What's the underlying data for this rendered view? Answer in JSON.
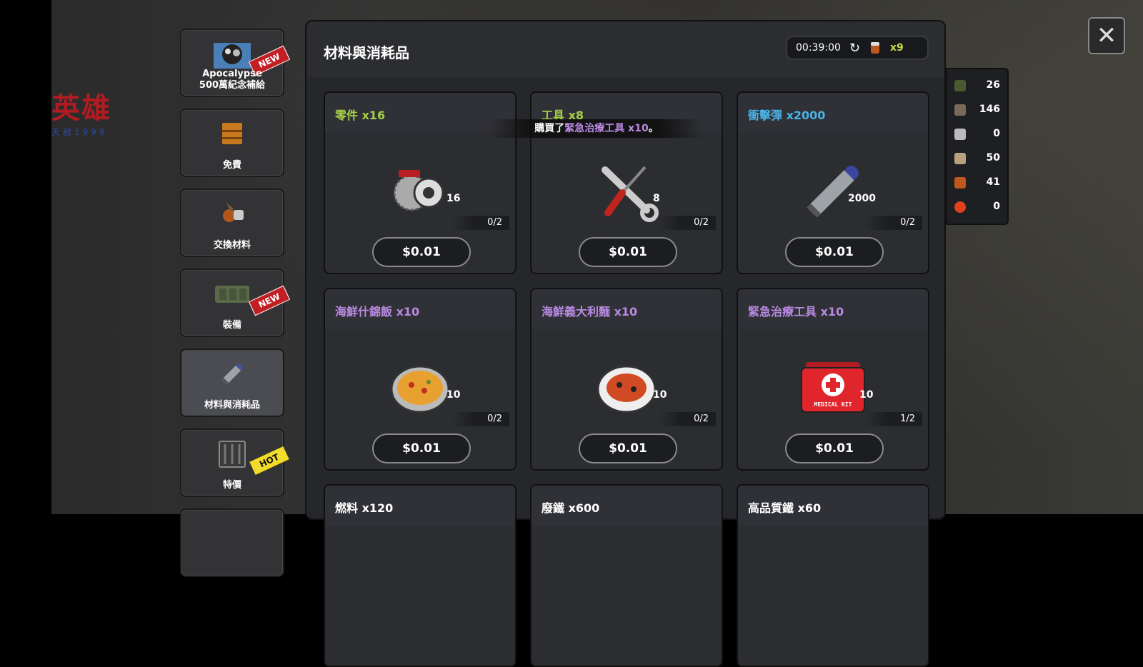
{
  "logo": {
    "title": "英雄",
    "subtitle": "天敌1999"
  },
  "title": "材料與消耗品",
  "timer": "00:39:00",
  "currency_count": "x9",
  "toast": {
    "prefix": "購買了",
    "item": "緊急治療工具 x10",
    "suffix": "。"
  },
  "sidebar": [
    {
      "label": "Apocalypse\n500萬紀念補給",
      "badge": "NEW",
      "icon": "apocalypse-icon"
    },
    {
      "label": "免費",
      "badge": "",
      "icon": "chest-icon"
    },
    {
      "label": "交換材料",
      "badge": "",
      "icon": "materials-icon"
    },
    {
      "label": "裝備",
      "badge": "NEW",
      "icon": "equipment-case-icon"
    },
    {
      "label": "材料與消耗品",
      "badge": "",
      "icon": "bullet-icon"
    },
    {
      "label": "特價",
      "badge": "HOT",
      "icon": "crate-icon"
    }
  ],
  "items": [
    {
      "name": "零件 x16",
      "qty": "16",
      "limit": "0/2",
      "price": "$0.01",
      "icon": "parts-icon",
      "color": "#a5cf4a"
    },
    {
      "name": "工具 x8",
      "qty": "8",
      "limit": "0/2",
      "price": "$0.01",
      "icon": "tools-icon",
      "color": "#a5cf4a"
    },
    {
      "name": "衝擊彈 x2000",
      "qty": "2000",
      "limit": "0/2",
      "price": "$0.01",
      "icon": "bullet-icon",
      "color": "#4ab2e4"
    },
    {
      "name": "海鮮什錦飯 x10",
      "qty": "10",
      "limit": "0/2",
      "price": "$0.01",
      "icon": "paella-icon",
      "color": "#b98ae2"
    },
    {
      "name": "海鮮義大利麵 x10",
      "qty": "10",
      "limit": "0/2",
      "price": "$0.01",
      "icon": "pasta-icon",
      "color": "#b98ae2"
    },
    {
      "name": "緊急治療工具 x10",
      "qty": "10",
      "limit": "1/2",
      "price": "$0.01",
      "icon": "medical-kit-icon",
      "color": "#b98ae2"
    },
    {
      "name": "燃料 x120",
      "icon": "fuel-icon",
      "color": "#ffffff"
    },
    {
      "name": "廢鐵 x600",
      "icon": "scrap-icon",
      "color": "#ffffff"
    },
    {
      "name": "高品質鐵 x60",
      "icon": "iron-icon",
      "color": "#ffffff"
    }
  ],
  "resources": [
    {
      "value": "26",
      "icon": "fuel-can-icon"
    },
    {
      "value": "146",
      "icon": "scrap-icon"
    },
    {
      "value": "0",
      "icon": "iron-bar-icon"
    },
    {
      "value": "50",
      "icon": "cloth-icon"
    },
    {
      "value": "41",
      "icon": "currency-icon"
    },
    {
      "value": "0",
      "icon": "fire-icon"
    }
  ],
  "medical_kit_text": "MEDICAL KIT"
}
